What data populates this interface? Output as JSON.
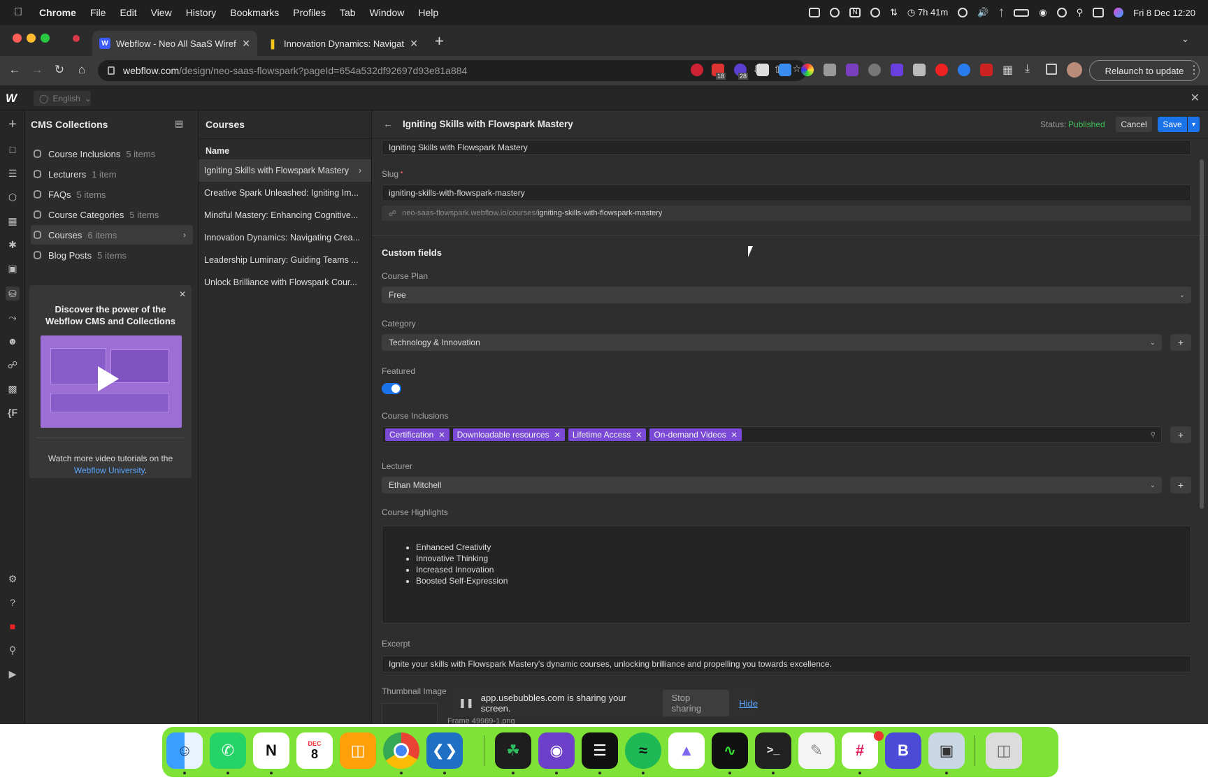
{
  "menubar": {
    "app": "Chrome",
    "items": [
      "File",
      "Edit",
      "View",
      "History",
      "Bookmarks",
      "Profiles",
      "Tab",
      "Window",
      "Help"
    ],
    "battery_time": "7h 41m",
    "datetime": "Fri 8 Dec  12:20"
  },
  "tabs": [
    {
      "title": "Webflow - Neo All SaaS Wiref",
      "active": true
    },
    {
      "title": "Innovation Dynamics: Navigat",
      "active": false
    }
  ],
  "address": {
    "domain": "webflow.com",
    "path": "/design/neo-saas-flowspark?pageId=654a532df92697d93e81a884",
    "relaunch_label": "Relaunch to update",
    "ext_badges": [
      "18",
      "28"
    ]
  },
  "webflow": {
    "language": "English"
  },
  "cms": {
    "title": "CMS Collections",
    "collections": [
      {
        "name": "Course Inclusions",
        "count": "5 items"
      },
      {
        "name": "Lecturers",
        "count": "1 item"
      },
      {
        "name": "FAQs",
        "count": "5 items"
      },
      {
        "name": "Course Categories",
        "count": "5 items"
      },
      {
        "name": "Courses",
        "count": "6 items"
      },
      {
        "name": "Blog Posts",
        "count": "5 items"
      }
    ],
    "promo": {
      "title": "Discover the power of the Webflow CMS and Collections",
      "subtitle": "Watch more video tutorials on the",
      "link": "Webflow University",
      "link_suffix": "."
    }
  },
  "courses": {
    "title": "Courses",
    "column": "Name",
    "items": [
      "Igniting Skills with Flowspark Mastery",
      "Creative Spark Unleashed: Igniting Im...",
      "Mindful Mastery: Enhancing Cognitive...",
      "Innovation Dynamics: Navigating Crea...",
      "Leadership Luminary: Guiding Teams ...",
      "Unlock Brilliance with Flowspark Cour..."
    ]
  },
  "editor": {
    "title": "Igniting Skills with Flowspark Mastery",
    "status_label": "Status:",
    "status_value": "Published",
    "cancel": "Cancel",
    "save": "Save",
    "name_value": "Igniting Skills with Flowspark Mastery",
    "slug_label": "Slug",
    "slug_value": "igniting-skills-with-flowspark-mastery",
    "url_prefix": "neo-saas-flowspark.webflow.io/courses/",
    "url_slug": "igniting-skills-with-flowspark-mastery",
    "custom_fields": "Custom fields",
    "course_plan_label": "Course Plan",
    "course_plan_value": "Free",
    "category_label": "Category",
    "category_value": "Technology & Innovation",
    "featured_label": "Featured",
    "featured_on": true,
    "inclusions_label": "Course Inclusions",
    "inclusions": [
      "Certification",
      "Downloadable resources",
      "Lifetime Access",
      "On-demand Videos"
    ],
    "lecturer_label": "Lecturer",
    "lecturer_value": "Ethan Mitchell",
    "highlights_label": "Course Highlights",
    "highlights": [
      "Enhanced Creativity",
      "Innovative Thinking",
      "Increased Innovation",
      "Boosted Self-Expression"
    ],
    "excerpt_label": "Excerpt",
    "excerpt_value": "Ignite your skills with Flowspark Mastery's dynamic courses, unlocking brilliance and propelling you towards excellence.",
    "thumbnail_label": "Thumbnail Image",
    "thumbnail_file": "Frame 49989-1.png"
  },
  "share_banner": {
    "text": "app.usebubbles.com is sharing your screen.",
    "stop": "Stop sharing",
    "hide": "Hide"
  },
  "dock": {
    "calendar_month": "DEC",
    "calendar_day": "8",
    "colors": {
      "bg": "#7fe236",
      "accent": "#1a73e8",
      "chip": "#7a4ad6",
      "published": "#3fbf5a"
    }
  }
}
